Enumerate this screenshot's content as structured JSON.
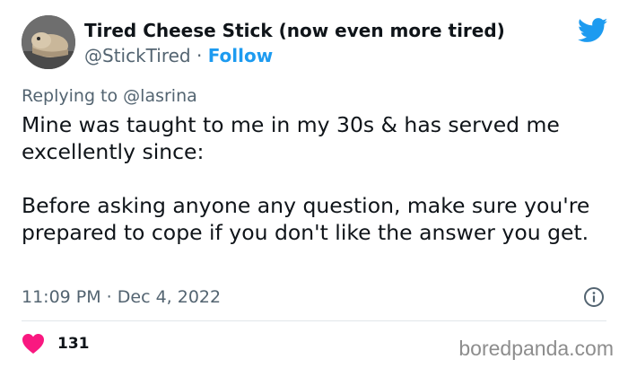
{
  "author": {
    "display_name": "Tired Cheese Stick (now even more tired)",
    "handle": "@StickTired",
    "separator": "·",
    "follow_label": "Follow"
  },
  "reply": {
    "prefix": "Replying to",
    "to_handle": "@lasrina"
  },
  "tweet": {
    "text": "Mine was taught to me in my 30s & has served me excellently since:\n\nBefore asking anyone any question, make sure you're prepared to cope if you don't like the answer you get.",
    "timestamp": "11:09 PM · Dec 4, 2022"
  },
  "engagement": {
    "likes": "131"
  },
  "watermark": "boredpanda.com",
  "colors": {
    "twitter_blue": "#1d9bf0",
    "heart": "#f91880",
    "secondary_text": "#536471"
  },
  "icons": [
    "twitter-bird-icon",
    "info-icon",
    "heart-icon"
  ]
}
